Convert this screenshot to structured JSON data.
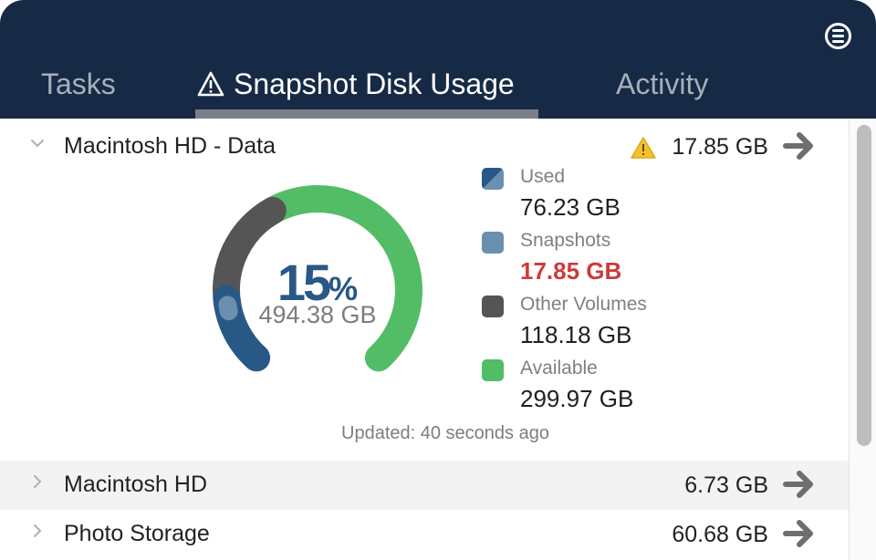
{
  "header": {
    "tabs": [
      {
        "label": "Tasks",
        "active": false
      },
      {
        "label": "Snapshot Disk Usage",
        "active": true,
        "icon": "warning-triangle-icon"
      },
      {
        "label": "Activity",
        "active": false
      }
    ],
    "menu_icon": "menu-circle-icon"
  },
  "volumes": [
    {
      "name": "Macintosh HD - Data",
      "expanded": true,
      "warning": true,
      "snapshot_size": "17.85 GB",
      "details": {
        "percent": "15",
        "percent_sign": "%",
        "total": "494.38 GB",
        "segments_gb": {
          "used": 76.23,
          "snapshots": 17.85,
          "other_volumes": 118.18,
          "available": 299.97
        },
        "legend": [
          {
            "label": "Used",
            "value": "76.23 GB",
            "key": "used"
          },
          {
            "label": "Snapshots",
            "value": "17.85 GB",
            "key": "snapshots",
            "alert": true
          },
          {
            "label": "Other Volumes",
            "value": "118.18 GB",
            "key": "other"
          },
          {
            "label": "Available",
            "value": "299.97 GB",
            "key": "available"
          }
        ],
        "updated": "Updated: 40 seconds ago"
      }
    },
    {
      "name": "Macintosh HD",
      "expanded": false,
      "snapshot_size": "6.73 GB"
    },
    {
      "name": "Photo Storage",
      "expanded": false,
      "snapshot_size": "60.68 GB"
    }
  ],
  "colors": {
    "header_bg": "#172a45",
    "used": "#285885",
    "snapshots": "#6b8fb0",
    "other": "#555555",
    "available": "#52bd66",
    "alert": "#cc3b3b",
    "warning": "#f2c12e"
  }
}
